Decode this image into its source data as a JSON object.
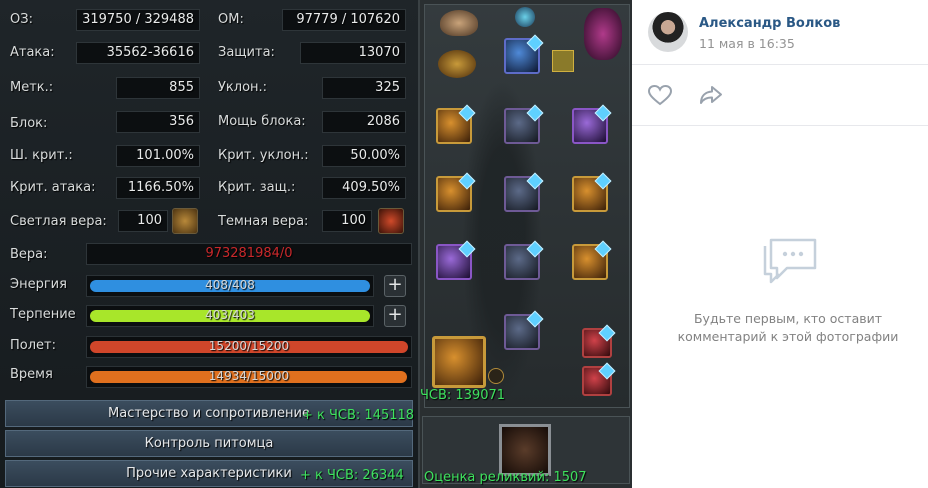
{
  "stats": {
    "hp": {
      "label": "ОЗ:",
      "value": "319750 / 329488"
    },
    "mp": {
      "label": "ОМ:",
      "value": "97779 / 107620"
    },
    "attack": {
      "label": "Атака:",
      "value": "35562-36616"
    },
    "defense": {
      "label": "Защита:",
      "value": "13070"
    },
    "accuracy": {
      "label": "Метк.:",
      "value": "855"
    },
    "evasion": {
      "label": "Уклон.:",
      "value": "325"
    },
    "block": {
      "label": "Блок:",
      "value": "356"
    },
    "block_power": {
      "label": "Мощь блока:",
      "value": "2086"
    },
    "crit_chance": {
      "label": "Ш. крит.:",
      "value": "101.00%"
    },
    "crit_evasion": {
      "label": "Крит. уклон.:",
      "value": "50.00%"
    },
    "crit_attack": {
      "label": "Крит. атака:",
      "value": "1166.50%"
    },
    "crit_defense": {
      "label": "Крит. защ.:",
      "value": "409.50%"
    },
    "light_faith": {
      "label": "Светлая вера:",
      "value": "100"
    },
    "dark_faith": {
      "label": "Темная вера:",
      "value": "100"
    },
    "faith": {
      "label": "Вера:",
      "value": "973281984/0"
    }
  },
  "bars": {
    "energy": {
      "label": "Энергия",
      "value": "408/408",
      "color": "#2f8fe0",
      "fraction": 1.0
    },
    "patience": {
      "label": "Терпение",
      "value": "403/403",
      "color": "#a8e62a",
      "fraction": 1.0
    },
    "flight": {
      "label": "Полет:",
      "value": "15200/15200",
      "color": "#d0462a",
      "fraction": 1.0
    },
    "time": {
      "label": "Время",
      "value": "14934/15000",
      "color": "#e0701e",
      "fraction": 0.9956
    }
  },
  "sections": {
    "mastery": "Мастерство и сопротивление",
    "pet": "Контроль питомца",
    "other": "Прочие характеристики"
  },
  "bonuses": {
    "mastery_bonus": "+ к ЧСВ: 145118",
    "equip_bonus": "ЧСВ: 139071",
    "other_bonus": "+ к ЧСВ: 26344",
    "relic_rating": "Оценка реликвий: 1507"
  },
  "post": {
    "author": "Александр Волков",
    "date": "11 мая в 16:35",
    "empty_comments": "Будьте первым, кто оставит комментарий к этой фотографии"
  },
  "colors": {
    "vk_link": "#2a5885",
    "green_text": "#3ee25e",
    "faith_red": "#c8282b"
  }
}
